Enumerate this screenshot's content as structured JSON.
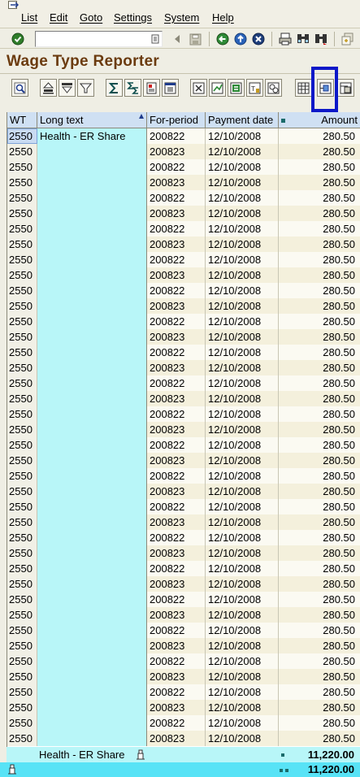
{
  "menu": {
    "items": [
      "List",
      "Edit",
      "Goto",
      "Settings",
      "System",
      "Help"
    ]
  },
  "toolbar": {
    "command_value": ""
  },
  "page": {
    "title": "Wage Type Reporter"
  },
  "table": {
    "columns": [
      "WT",
      "Long text",
      "For-period",
      "Payment date",
      "Amount"
    ],
    "rows": [
      {
        "wt": "2550",
        "long_text": "Health - ER Share",
        "for_period": "200822",
        "payment_date": "12/10/2008",
        "amount": "280.50"
      },
      {
        "wt": "2550",
        "long_text": "",
        "for_period": "200823",
        "payment_date": "12/10/2008",
        "amount": "280.50"
      },
      {
        "wt": "2550",
        "long_text": "",
        "for_period": "200822",
        "payment_date": "12/10/2008",
        "amount": "280.50"
      },
      {
        "wt": "2550",
        "long_text": "",
        "for_period": "200823",
        "payment_date": "12/10/2008",
        "amount": "280.50"
      },
      {
        "wt": "2550",
        "long_text": "",
        "for_period": "200822",
        "payment_date": "12/10/2008",
        "amount": "280.50"
      },
      {
        "wt": "2550",
        "long_text": "",
        "for_period": "200823",
        "payment_date": "12/10/2008",
        "amount": "280.50"
      },
      {
        "wt": "2550",
        "long_text": "",
        "for_period": "200822",
        "payment_date": "12/10/2008",
        "amount": "280.50"
      },
      {
        "wt": "2550",
        "long_text": "",
        "for_period": "200823",
        "payment_date": "12/10/2008",
        "amount": "280.50"
      },
      {
        "wt": "2550",
        "long_text": "",
        "for_period": "200822",
        "payment_date": "12/10/2008",
        "amount": "280.50"
      },
      {
        "wt": "2550",
        "long_text": "",
        "for_period": "200823",
        "payment_date": "12/10/2008",
        "amount": "280.50"
      },
      {
        "wt": "2550",
        "long_text": "",
        "for_period": "200822",
        "payment_date": "12/10/2008",
        "amount": "280.50"
      },
      {
        "wt": "2550",
        "long_text": "",
        "for_period": "200823",
        "payment_date": "12/10/2008",
        "amount": "280.50"
      },
      {
        "wt": "2550",
        "long_text": "",
        "for_period": "200822",
        "payment_date": "12/10/2008",
        "amount": "280.50"
      },
      {
        "wt": "2550",
        "long_text": "",
        "for_period": "200823",
        "payment_date": "12/10/2008",
        "amount": "280.50"
      },
      {
        "wt": "2550",
        "long_text": "",
        "for_period": "200822",
        "payment_date": "12/10/2008",
        "amount": "280.50"
      },
      {
        "wt": "2550",
        "long_text": "",
        "for_period": "200823",
        "payment_date": "12/10/2008",
        "amount": "280.50"
      },
      {
        "wt": "2550",
        "long_text": "",
        "for_period": "200822",
        "payment_date": "12/10/2008",
        "amount": "280.50"
      },
      {
        "wt": "2550",
        "long_text": "",
        "for_period": "200823",
        "payment_date": "12/10/2008",
        "amount": "280.50"
      },
      {
        "wt": "2550",
        "long_text": "",
        "for_period": "200822",
        "payment_date": "12/10/2008",
        "amount": "280.50"
      },
      {
        "wt": "2550",
        "long_text": "",
        "for_period": "200823",
        "payment_date": "12/10/2008",
        "amount": "280.50"
      },
      {
        "wt": "2550",
        "long_text": "",
        "for_period": "200822",
        "payment_date": "12/10/2008",
        "amount": "280.50"
      },
      {
        "wt": "2550",
        "long_text": "",
        "for_period": "200823",
        "payment_date": "12/10/2008",
        "amount": "280.50"
      },
      {
        "wt": "2550",
        "long_text": "",
        "for_period": "200822",
        "payment_date": "12/10/2008",
        "amount": "280.50"
      },
      {
        "wt": "2550",
        "long_text": "",
        "for_period": "200823",
        "payment_date": "12/10/2008",
        "amount": "280.50"
      },
      {
        "wt": "2550",
        "long_text": "",
        "for_period": "200822",
        "payment_date": "12/10/2008",
        "amount": "280.50"
      },
      {
        "wt": "2550",
        "long_text": "",
        "for_period": "200823",
        "payment_date": "12/10/2008",
        "amount": "280.50"
      },
      {
        "wt": "2550",
        "long_text": "",
        "for_period": "200822",
        "payment_date": "12/10/2008",
        "amount": "280.50"
      },
      {
        "wt": "2550",
        "long_text": "",
        "for_period": "200823",
        "payment_date": "12/10/2008",
        "amount": "280.50"
      },
      {
        "wt": "2550",
        "long_text": "",
        "for_period": "200822",
        "payment_date": "12/10/2008",
        "amount": "280.50"
      },
      {
        "wt": "2550",
        "long_text": "",
        "for_period": "200823",
        "payment_date": "12/10/2008",
        "amount": "280.50"
      },
      {
        "wt": "2550",
        "long_text": "",
        "for_period": "200822",
        "payment_date": "12/10/2008",
        "amount": "280.50"
      },
      {
        "wt": "2550",
        "long_text": "",
        "for_period": "200823",
        "payment_date": "12/10/2008",
        "amount": "280.50"
      },
      {
        "wt": "2550",
        "long_text": "",
        "for_period": "200822",
        "payment_date": "12/10/2008",
        "amount": "280.50"
      },
      {
        "wt": "2550",
        "long_text": "",
        "for_period": "200823",
        "payment_date": "12/10/2008",
        "amount": "280.50"
      },
      {
        "wt": "2550",
        "long_text": "",
        "for_period": "200822",
        "payment_date": "12/10/2008",
        "amount": "280.50"
      },
      {
        "wt": "2550",
        "long_text": "",
        "for_period": "200823",
        "payment_date": "12/10/2008",
        "amount": "280.50"
      },
      {
        "wt": "2550",
        "long_text": "",
        "for_period": "200822",
        "payment_date": "12/10/2008",
        "amount": "280.50"
      },
      {
        "wt": "2550",
        "long_text": "",
        "for_period": "200823",
        "payment_date": "12/10/2008",
        "amount": "280.50"
      },
      {
        "wt": "2550",
        "long_text": "",
        "for_period": "200822",
        "payment_date": "12/10/2008",
        "amount": "280.50"
      },
      {
        "wt": "2550",
        "long_text": "",
        "for_period": "200823",
        "payment_date": "12/10/2008",
        "amount": "280.50"
      }
    ]
  },
  "subtotal": {
    "label": "Health - ER Share",
    "amount": "11,220.00"
  },
  "total": {
    "amount": "11,220.00"
  },
  "colors": {
    "title": "#6b3b0f",
    "header_bg": "#cfe0f3",
    "long_text_bg": "#b8f6f8",
    "total_bg": "#58e3f6",
    "highlight_box": "#0d18c8"
  },
  "icons": {
    "standard_toolbar": [
      "enter-checkmark-icon",
      "command-field-dropdown-icon",
      "back-arrow-icon",
      "save-icon",
      "back-green-icon",
      "exit-up-icon",
      "cancel-icon",
      "print-icon",
      "find-icon",
      "find-next-icon",
      "create-session-icon"
    ],
    "alv_toolbar": [
      "details-icon",
      "sort-ascending-icon",
      "sort-descending-icon",
      "set-filter-icon",
      "sum-icon",
      "subtotals-icon",
      "print-preview-icon",
      "export-icon",
      "abc-analysis-icon",
      "graphic-icon",
      "word-processing-icon",
      "local-file-icon",
      "change-layout-icon",
      "select-layout-icon",
      "save-layout-icon"
    ]
  }
}
